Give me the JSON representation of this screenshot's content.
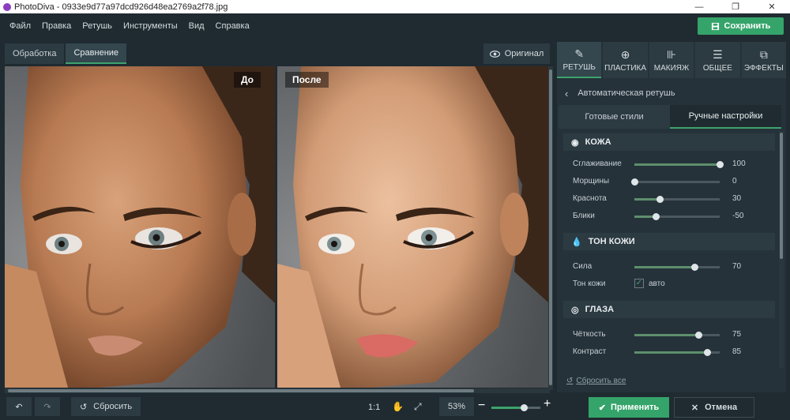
{
  "window": {
    "title": "PhotoDiva - 0933e9d77a97dcd926d48ea2769a2f78.jpg",
    "minimize": "—",
    "maximize": "❐",
    "close": "✕"
  },
  "menu": [
    "Файл",
    "Правка",
    "Ретушь",
    "Инструменты",
    "Вид",
    "Справка"
  ],
  "save_button": "Сохранить",
  "view_tabs": [
    {
      "label": "Обработка",
      "active": false
    },
    {
      "label": "Сравнение",
      "active": true
    }
  ],
  "original_button": "Оригинал",
  "photos": {
    "before_label": "До",
    "after_label": "После"
  },
  "panel": {
    "tabs": [
      {
        "label": "РЕТУШЬ",
        "icon": "brush-icon",
        "active": true
      },
      {
        "label": "ПЛАСТИКА",
        "icon": "target-icon",
        "active": false
      },
      {
        "label": "МАКИЯЖ",
        "icon": "makeup-icon",
        "active": false
      },
      {
        "label": "ОБЩЕЕ",
        "icon": "sliders-icon",
        "active": false
      },
      {
        "label": "ЭФФЕКТЫ",
        "icon": "effects-icon",
        "active": false
      }
    ],
    "back_title": "Автоматическая ретушь",
    "subtabs": [
      {
        "label": "Готовые стили",
        "active": false
      },
      {
        "label": "Ручные настройки",
        "active": true
      }
    ],
    "sections": {
      "skin": {
        "title": "КОЖА",
        "sliders": [
          {
            "label": "Сглаживание",
            "value": "100",
            "level": 1.0
          },
          {
            "label": "Морщины",
            "value": "0",
            "level": 0.0
          },
          {
            "label": "Краснота",
            "value": "30",
            "level": 0.3
          },
          {
            "label": "Блики",
            "value": "-50",
            "level": 0.25
          }
        ]
      },
      "tone": {
        "title": "ТОН КОЖИ",
        "sliders": [
          {
            "label": "Сила",
            "value": "70",
            "level": 0.7
          }
        ],
        "checkbox_label": "Тон кожи",
        "checkbox_text": "авто",
        "checked": true
      },
      "eyes": {
        "title": "ГЛАЗА",
        "sliders": [
          {
            "label": "Чёткость",
            "value": "75",
            "level": 0.75
          },
          {
            "label": "Контраст",
            "value": "85",
            "level": 0.85
          }
        ]
      }
    },
    "reset_all": "Сбросить все"
  },
  "bottom": {
    "reset": "Сбросить",
    "one_to_one": "1:1",
    "zoom": "53%",
    "zoom_level": 0.6,
    "apply": "Применить",
    "cancel": "Отмена"
  },
  "colors": {
    "accent": "#35a46a",
    "background": "#1f2b31",
    "panel": "#25323a"
  }
}
